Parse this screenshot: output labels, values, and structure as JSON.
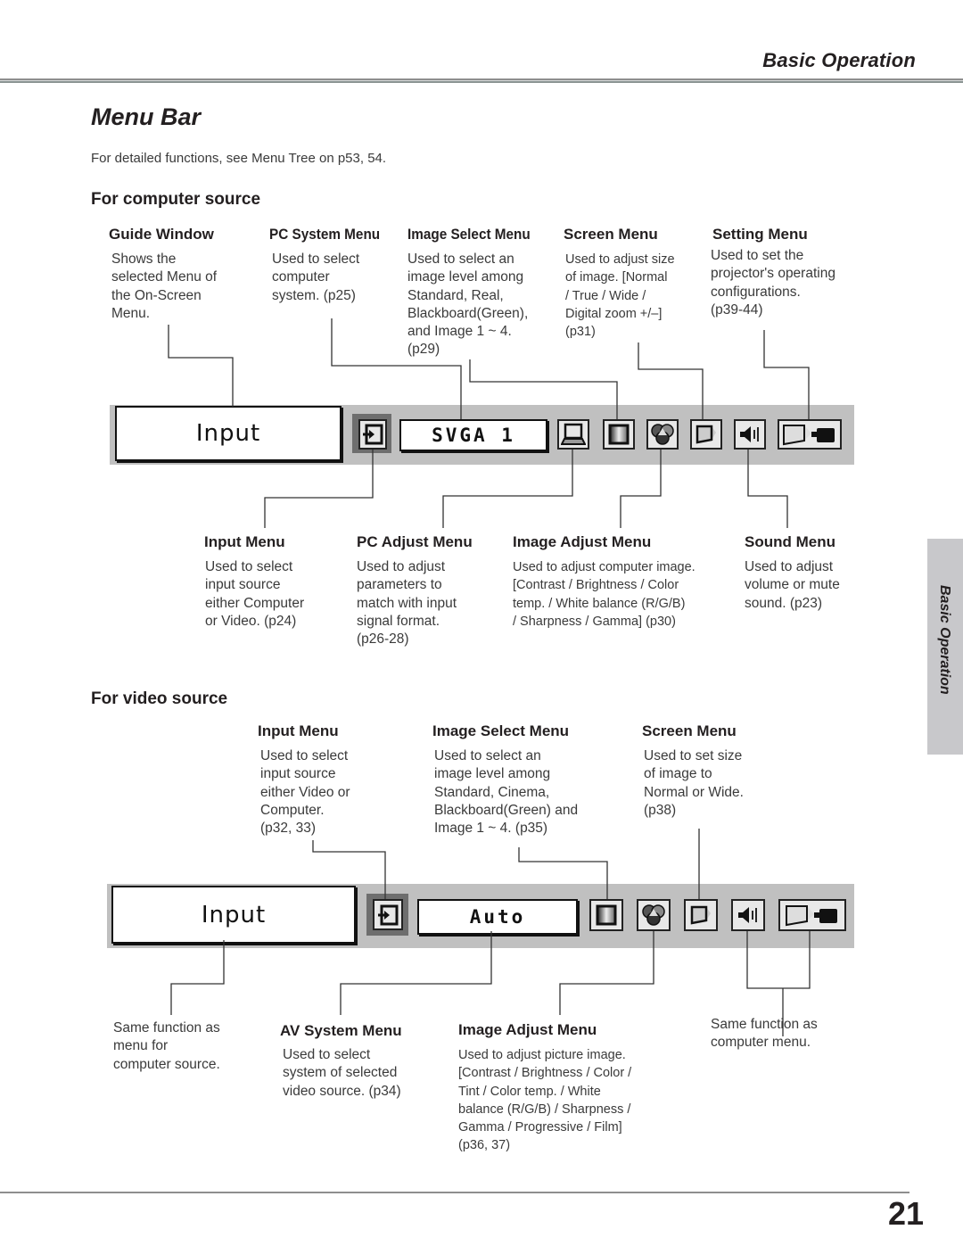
{
  "header": {
    "section": "Basic Operation"
  },
  "page": {
    "title": "Menu Bar",
    "intro": "For detailed functions, see Menu Tree on p53, 54.",
    "number": "21"
  },
  "side_tab": {
    "label": "Basic Operation"
  },
  "computer": {
    "heading": "For computer source",
    "top_callouts": [
      {
        "label": "Guide Window",
        "text": "Shows the\nselected Menu of\nthe On-Screen\nMenu."
      },
      {
        "label": "PC System Menu",
        "text": "Used to select\ncomputer\nsystem.  (p25)"
      },
      {
        "label": "Image Select Menu",
        "text": "Used to select  an\nimage level among\nStandard, Real,\nBlackboard(Green),\nand Image 1 ~ 4.\n(p29)"
      },
      {
        "label": "Screen Menu",
        "text": "Used to adjust size\nof image.  [Normal\n/ True / Wide /\nDigital zoom +/–]\n(p31)"
      },
      {
        "label": "Setting Menu",
        "text": "Used to set the\nprojector's operating\nconfigurations.\n (p39-44)"
      }
    ],
    "bottom_callouts": [
      {
        "label": "Input Menu",
        "text": "Used to select\ninput source\neither Computer\nor Video.  (p24)"
      },
      {
        "label": "PC Adjust Menu",
        "text": "Used to adjust\nparameters to\nmatch with input\nsignal format.\n(p26-28)"
      },
      {
        "label": "Image Adjust Menu",
        "text": "Used to adjust computer image.\n[Contrast / Brightness / Color\ntemp. /  White balance (R/G/B)\n/ Sharpness /  Gamma]   (p30)"
      },
      {
        "label": "Sound Menu",
        "text": "Used to adjust\nvolume or mute\nsound.  (p23)"
      }
    ],
    "menubar": {
      "guide_text": "Input",
      "system_value": "SVGA 1",
      "icons": [
        "input-icon",
        "pc-adjust-icon",
        "image-select-icon",
        "image-adjust-icon",
        "screen-icon",
        "sound-icon",
        "setting-icon"
      ]
    }
  },
  "video": {
    "heading": "For video source",
    "top_callouts": [
      {
        "label": "Input Menu",
        "text": "Used to select\ninput source\neither Video or\nComputer.\n(p32, 33)"
      },
      {
        "label": "Image Select Menu",
        "text": "Used to select an\nimage level among\nStandard, Cinema,\nBlackboard(Green) and\nImage 1 ~ 4.  (p35)"
      },
      {
        "label": "Screen Menu",
        "text": "Used to set size\nof image to\nNormal or Wide.\n(p38)"
      }
    ],
    "bottom_callouts": [
      {
        "label": "",
        "text": "Same function as\nmenu for\ncomputer source."
      },
      {
        "label": "AV System Menu",
        "text": "Used to select\nsystem of selected\nvideo source.  (p34)"
      },
      {
        "label": "Image Adjust Menu",
        "text": " Used to adjust picture image.\n[Contrast / Brightness / Color /\nTint / Color temp. / White\nbalance (R/G/B) / Sharpness /\nGamma / Progressive / Film]\n (p36, 37)"
      },
      {
        "label": "",
        "text": "Same function as\ncomputer menu."
      }
    ],
    "menubar": {
      "guide_text": "Input",
      "system_value": "Auto",
      "icons": [
        "input-icon",
        "image-select-icon",
        "image-adjust-icon",
        "screen-icon",
        "sound-icon",
        "setting-icon"
      ]
    }
  }
}
